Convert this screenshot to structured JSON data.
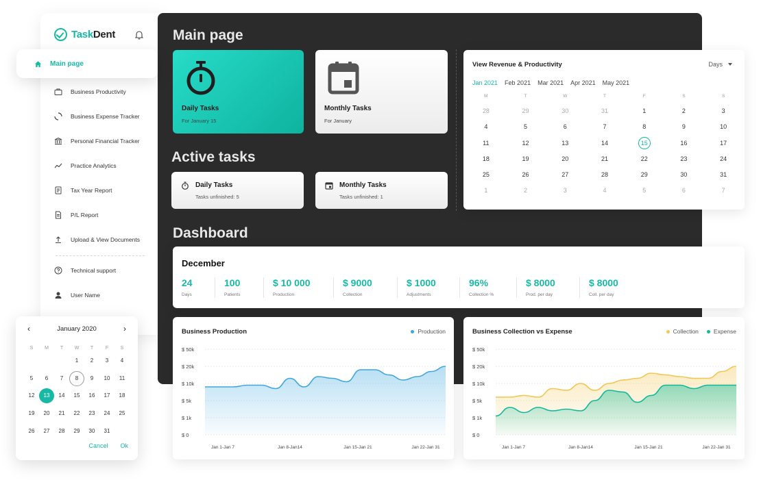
{
  "app": {
    "logo_text_1": "Task",
    "logo_text_2": "Dent"
  },
  "sidebar": {
    "active_item": "Main page",
    "items": [
      {
        "label": "Business Productivity",
        "icon": "briefcase-icon"
      },
      {
        "label": "Business Expense Tracker",
        "icon": "spinner-icon"
      },
      {
        "label": "Personal Financial Tracker",
        "icon": "bank-icon"
      },
      {
        "label": "Practice Analytics",
        "icon": "trend-icon"
      },
      {
        "label": "Tax Year Report",
        "icon": "report-icon"
      },
      {
        "label": "P/L Report",
        "icon": "document-icon"
      },
      {
        "label": "Upload & View Documents",
        "icon": "upload-icon"
      }
    ],
    "support": "Technical support",
    "user": "User Name"
  },
  "main": {
    "title": "Main page",
    "daily_card": {
      "title": "Daily Tasks",
      "sub": "For January 15"
    },
    "monthly_card": {
      "title": "Monthly Tasks",
      "sub": "For January"
    }
  },
  "active": {
    "title": "Active tasks",
    "daily": {
      "title": "Daily Tasks",
      "sub": "Tasks unfinished: 5"
    },
    "monthly": {
      "title": "Monthly Tasks",
      "sub": "Tasks unfinished: 1"
    }
  },
  "calendar": {
    "title": "View Revenue & Productivity",
    "range_select": "Days",
    "months": [
      "Jan 2021",
      "Feb 2021",
      "Mar 2021",
      "Apr 2021",
      "May 2021"
    ],
    "weekdays": [
      "M",
      "T",
      "W",
      "T",
      "F",
      "S",
      "S"
    ],
    "weeks": [
      [
        "28",
        "29",
        "30",
        "31",
        "1",
        "2",
        "3"
      ],
      [
        "4",
        "5",
        "6",
        "7",
        "8",
        "9",
        "10"
      ],
      [
        "11",
        "12",
        "13",
        "14",
        "15",
        "16",
        "17"
      ],
      [
        "18",
        "19",
        "20",
        "21",
        "22",
        "23",
        "24"
      ],
      [
        "25",
        "26",
        "27",
        "28",
        "29",
        "30",
        "31"
      ],
      [
        "1",
        "2",
        "3",
        "4",
        "5",
        "6",
        "7"
      ]
    ],
    "selected": "15"
  },
  "dashboard": {
    "title": "Dashboard",
    "period": "December",
    "stats": [
      {
        "value": "24",
        "label": "Days"
      },
      {
        "value": "100",
        "label": "Patients"
      },
      {
        "value": "$ 10 000",
        "label": "Production"
      },
      {
        "value": "$ 9000",
        "label": "Collection"
      },
      {
        "value": "$ 1000",
        "label": "Adjustments"
      },
      {
        "value": "96%",
        "label": "Collection %"
      },
      {
        "value": "$ 8000",
        "label": "Prod. per day"
      },
      {
        "value": "$ 8000",
        "label": "Coll. per day"
      }
    ]
  },
  "colors": {
    "accent": "#18b9a4",
    "production": "#3fa7dc",
    "collection": "#f3c64f",
    "expense": "#13b89c",
    "panel": "#2b2b2b"
  },
  "chart_data": [
    {
      "type": "area",
      "title": "Business Production",
      "y_ticks": [
        "$ 50k",
        "$ 20k",
        "$ 10k",
        "$ 5k",
        "$ 1k",
        "$ 0"
      ],
      "x_ticks": [
        "Jan 1-Jan 7",
        "Jan 8-Jan14",
        "Jan 15-Jan 21",
        "Jan 22-Jan 31"
      ],
      "series": [
        {
          "name": "Production",
          "values": [
            2.8,
            2.8,
            2.8,
            2.9,
            2.9,
            2.7,
            3.3,
            2.8,
            3.4,
            3.3,
            3.1,
            3.8,
            3.8,
            3.5,
            3.2,
            3.4,
            3.7,
            4.0
          ]
        }
      ]
    },
    {
      "type": "area",
      "title": "Business Collection vs Expense",
      "y_ticks": [
        "$ 50k",
        "$ 20k",
        "$ 10k",
        "$ 5k",
        "$ 1k",
        "$ 0"
      ],
      "x_ticks": [
        "Jan 1-Jan 7",
        "Jan 8-Jan14",
        "Jan 15-Jan 21",
        "Jan 22-Jan 31"
      ],
      "series": [
        {
          "name": "Collection",
          "values": [
            2.2,
            2.2,
            2.3,
            2.2,
            2.7,
            2.6,
            3.0,
            2.6,
            3.0,
            3.2,
            3.3,
            3.6,
            3.5,
            3.4,
            3.3,
            3.3,
            3.7,
            4.0
          ]
        },
        {
          "name": "Expense",
          "values": [
            1.1,
            1.6,
            1.3,
            1.6,
            1.4,
            1.5,
            1.4,
            2.0,
            2.6,
            2.5,
            1.9,
            2.3,
            2.9,
            2.9,
            2.7,
            2.9,
            2.9,
            2.9
          ]
        }
      ]
    }
  ],
  "mini_calendar": {
    "title": "January 2020",
    "weekdays": [
      "S",
      "M",
      "T",
      "W",
      "T",
      "F",
      "S"
    ],
    "days": [
      [
        "",
        "",
        "",
        "1",
        "2",
        "3",
        "4"
      ],
      [
        "5",
        "6",
        "7",
        "8",
        "9",
        "10",
        "11"
      ],
      [
        "12",
        "13",
        "14",
        "15",
        "16",
        "17",
        "18"
      ],
      [
        "19",
        "20",
        "21",
        "22",
        "23",
        "24",
        "25"
      ],
      [
        "26",
        "27",
        "28",
        "29",
        "30",
        "31",
        ""
      ]
    ],
    "outlined": "8",
    "selected": "13",
    "cancel": "Cancel",
    "ok": "Ok"
  }
}
